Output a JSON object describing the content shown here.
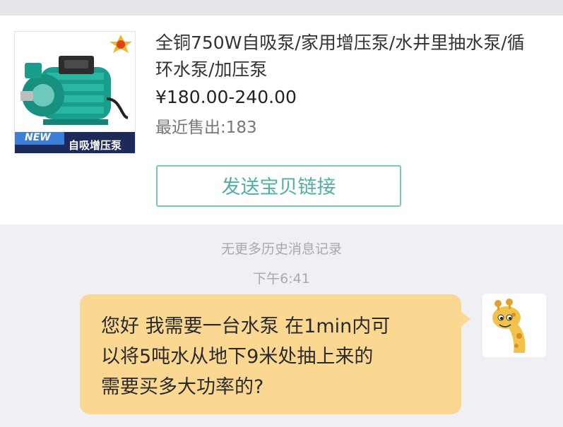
{
  "product": {
    "title": "全铜750W自吸泵/家用增压泵/水井里抽水泵/循环水泵/加压泵",
    "price": "¥180.00-240.00",
    "sold": "最近售出:183",
    "image_badge_new": "NEW",
    "image_caption": "自吸增压泵"
  },
  "actions": {
    "send_link_label": "发送宝贝链接"
  },
  "chat": {
    "no_history": "无更多历史消息记录",
    "timestamp": "下午6:41",
    "messages": [
      {
        "sender": "me",
        "text": "您好 我需要一台水泵 在1min内可\n以将5吨水从地下9米处抽上来的\n需要买多大功率的?"
      }
    ]
  },
  "colors": {
    "accent": "#4fb0a1",
    "bubble": "#fbd892",
    "background": "#efeff4"
  },
  "icons": {
    "avatar": "giraffe-avatar-icon",
    "product": "water-pump-image"
  }
}
